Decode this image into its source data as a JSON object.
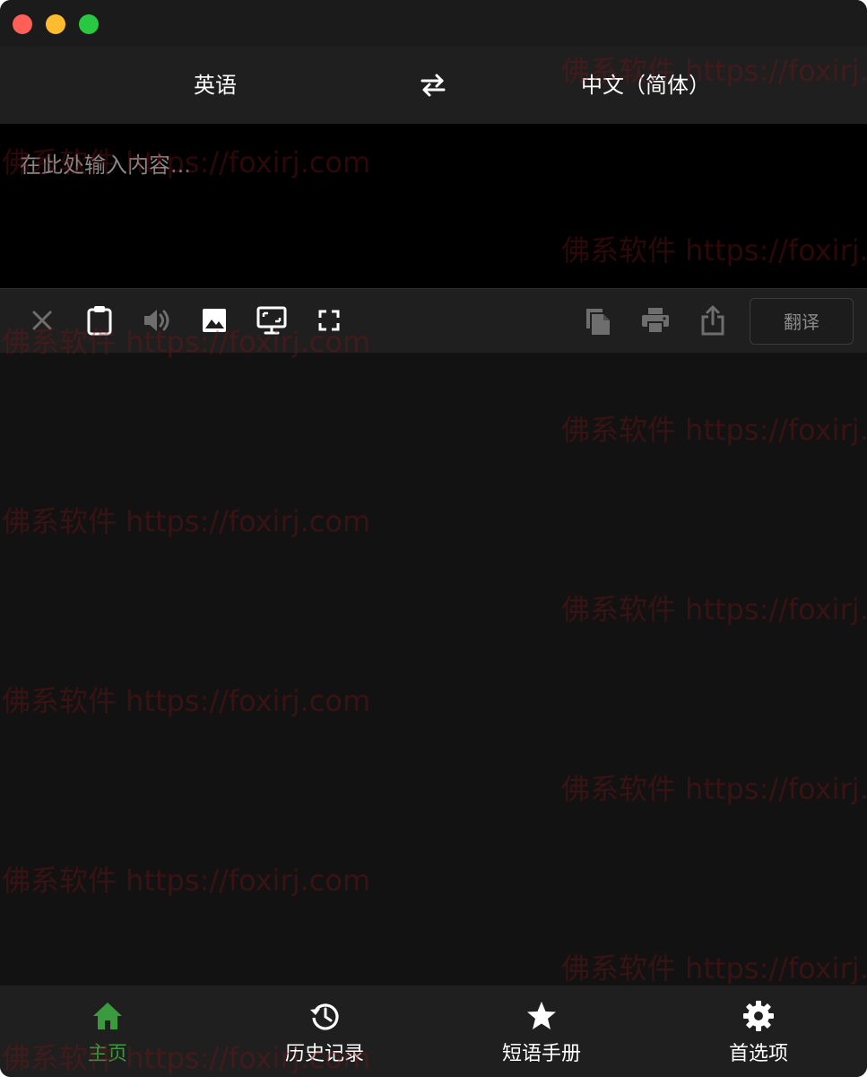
{
  "colors": {
    "window_bg": "#121212",
    "bar_bg": "#1f1f1f",
    "input_bg": "#000000",
    "accent_green": "#3a9a3e",
    "traffic_close": "#fe5f57",
    "traffic_minimize": "#febc2e",
    "traffic_maximize": "#28c840"
  },
  "language_bar": {
    "source_language": "英语",
    "target_language": "中文（简体）",
    "swap_icon": "swap-arrows-icon"
  },
  "input": {
    "placeholder": "在此处输入内容...",
    "value": ""
  },
  "toolbar": {
    "left_icons": [
      "close-icon",
      "clipboard-icon",
      "speaker-icon",
      "image-icon",
      "screen-capture-icon",
      "fullscreen-icon"
    ],
    "right_icons": [
      "copy-icon",
      "print-icon",
      "share-icon"
    ],
    "translate_label": "翻译"
  },
  "bottom_nav": {
    "items": [
      {
        "label": "主页",
        "icon": "home-icon",
        "active": true
      },
      {
        "label": "历史记录",
        "icon": "history-icon",
        "active": false
      },
      {
        "label": "短语手册",
        "icon": "star-icon",
        "active": false
      },
      {
        "label": "首选项",
        "icon": "gear-icon",
        "active": false
      }
    ]
  },
  "watermark": {
    "text": "佛系软件 https://foxirj.com"
  }
}
